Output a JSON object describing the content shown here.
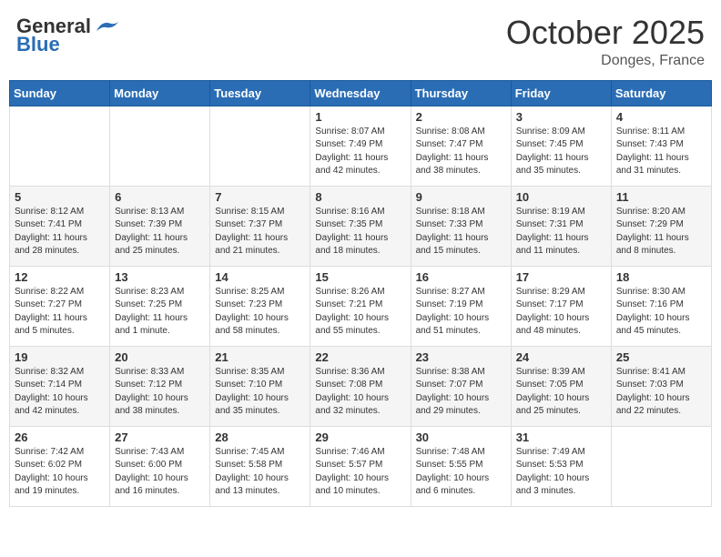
{
  "header": {
    "logo_general": "General",
    "logo_blue": "Blue",
    "month_title": "October 2025",
    "location": "Donges, France"
  },
  "days_of_week": [
    "Sunday",
    "Monday",
    "Tuesday",
    "Wednesday",
    "Thursday",
    "Friday",
    "Saturday"
  ],
  "weeks": [
    [
      {
        "day": "",
        "info": ""
      },
      {
        "day": "",
        "info": ""
      },
      {
        "day": "",
        "info": ""
      },
      {
        "day": "1",
        "info": "Sunrise: 8:07 AM\nSunset: 7:49 PM\nDaylight: 11 hours\nand 42 minutes."
      },
      {
        "day": "2",
        "info": "Sunrise: 8:08 AM\nSunset: 7:47 PM\nDaylight: 11 hours\nand 38 minutes."
      },
      {
        "day": "3",
        "info": "Sunrise: 8:09 AM\nSunset: 7:45 PM\nDaylight: 11 hours\nand 35 minutes."
      },
      {
        "day": "4",
        "info": "Sunrise: 8:11 AM\nSunset: 7:43 PM\nDaylight: 11 hours\nand 31 minutes."
      }
    ],
    [
      {
        "day": "5",
        "info": "Sunrise: 8:12 AM\nSunset: 7:41 PM\nDaylight: 11 hours\nand 28 minutes."
      },
      {
        "day": "6",
        "info": "Sunrise: 8:13 AM\nSunset: 7:39 PM\nDaylight: 11 hours\nand 25 minutes."
      },
      {
        "day": "7",
        "info": "Sunrise: 8:15 AM\nSunset: 7:37 PM\nDaylight: 11 hours\nand 21 minutes."
      },
      {
        "day": "8",
        "info": "Sunrise: 8:16 AM\nSunset: 7:35 PM\nDaylight: 11 hours\nand 18 minutes."
      },
      {
        "day": "9",
        "info": "Sunrise: 8:18 AM\nSunset: 7:33 PM\nDaylight: 11 hours\nand 15 minutes."
      },
      {
        "day": "10",
        "info": "Sunrise: 8:19 AM\nSunset: 7:31 PM\nDaylight: 11 hours\nand 11 minutes."
      },
      {
        "day": "11",
        "info": "Sunrise: 8:20 AM\nSunset: 7:29 PM\nDaylight: 11 hours\nand 8 minutes."
      }
    ],
    [
      {
        "day": "12",
        "info": "Sunrise: 8:22 AM\nSunset: 7:27 PM\nDaylight: 11 hours\nand 5 minutes."
      },
      {
        "day": "13",
        "info": "Sunrise: 8:23 AM\nSunset: 7:25 PM\nDaylight: 11 hours\nand 1 minute."
      },
      {
        "day": "14",
        "info": "Sunrise: 8:25 AM\nSunset: 7:23 PM\nDaylight: 10 hours\nand 58 minutes."
      },
      {
        "day": "15",
        "info": "Sunrise: 8:26 AM\nSunset: 7:21 PM\nDaylight: 10 hours\nand 55 minutes."
      },
      {
        "day": "16",
        "info": "Sunrise: 8:27 AM\nSunset: 7:19 PM\nDaylight: 10 hours\nand 51 minutes."
      },
      {
        "day": "17",
        "info": "Sunrise: 8:29 AM\nSunset: 7:17 PM\nDaylight: 10 hours\nand 48 minutes."
      },
      {
        "day": "18",
        "info": "Sunrise: 8:30 AM\nSunset: 7:16 PM\nDaylight: 10 hours\nand 45 minutes."
      }
    ],
    [
      {
        "day": "19",
        "info": "Sunrise: 8:32 AM\nSunset: 7:14 PM\nDaylight: 10 hours\nand 42 minutes."
      },
      {
        "day": "20",
        "info": "Sunrise: 8:33 AM\nSunset: 7:12 PM\nDaylight: 10 hours\nand 38 minutes."
      },
      {
        "day": "21",
        "info": "Sunrise: 8:35 AM\nSunset: 7:10 PM\nDaylight: 10 hours\nand 35 minutes."
      },
      {
        "day": "22",
        "info": "Sunrise: 8:36 AM\nSunset: 7:08 PM\nDaylight: 10 hours\nand 32 minutes."
      },
      {
        "day": "23",
        "info": "Sunrise: 8:38 AM\nSunset: 7:07 PM\nDaylight: 10 hours\nand 29 minutes."
      },
      {
        "day": "24",
        "info": "Sunrise: 8:39 AM\nSunset: 7:05 PM\nDaylight: 10 hours\nand 25 minutes."
      },
      {
        "day": "25",
        "info": "Sunrise: 8:41 AM\nSunset: 7:03 PM\nDaylight: 10 hours\nand 22 minutes."
      }
    ],
    [
      {
        "day": "26",
        "info": "Sunrise: 7:42 AM\nSunset: 6:02 PM\nDaylight: 10 hours\nand 19 minutes."
      },
      {
        "day": "27",
        "info": "Sunrise: 7:43 AM\nSunset: 6:00 PM\nDaylight: 10 hours\nand 16 minutes."
      },
      {
        "day": "28",
        "info": "Sunrise: 7:45 AM\nSunset: 5:58 PM\nDaylight: 10 hours\nand 13 minutes."
      },
      {
        "day": "29",
        "info": "Sunrise: 7:46 AM\nSunset: 5:57 PM\nDaylight: 10 hours\nand 10 minutes."
      },
      {
        "day": "30",
        "info": "Sunrise: 7:48 AM\nSunset: 5:55 PM\nDaylight: 10 hours\nand 6 minutes."
      },
      {
        "day": "31",
        "info": "Sunrise: 7:49 AM\nSunset: 5:53 PM\nDaylight: 10 hours\nand 3 minutes."
      },
      {
        "day": "",
        "info": ""
      }
    ]
  ]
}
